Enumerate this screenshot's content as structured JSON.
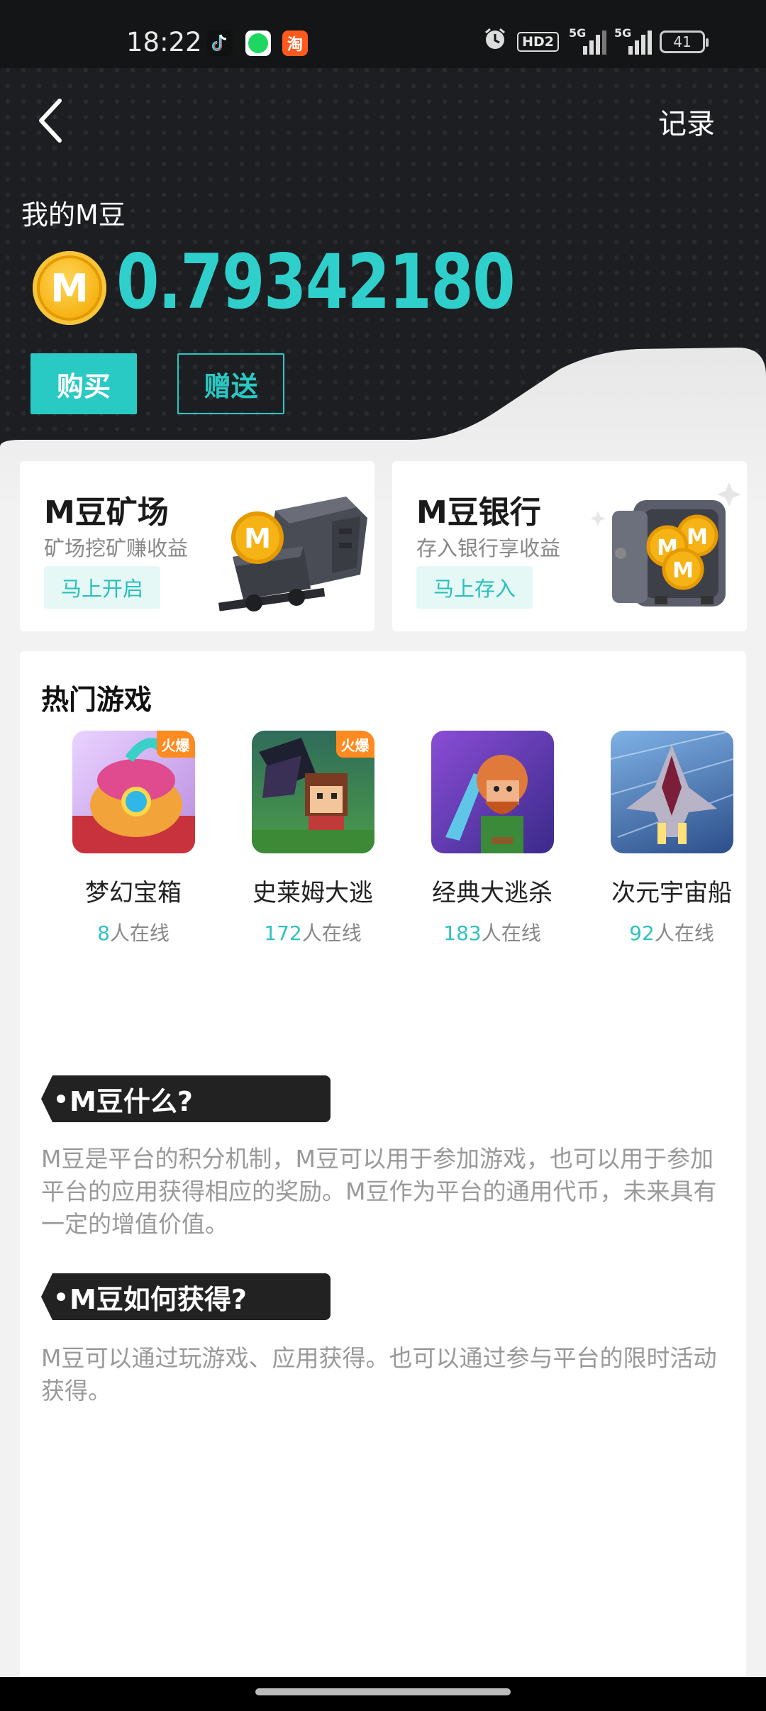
{
  "status_bar": {
    "time": "18:22",
    "apps": [
      "tiktok-icon",
      "spotify-icon",
      "taobao-icon"
    ],
    "taobao_glyph": "淘",
    "hd_label": "HD2",
    "network_labels": [
      "5G",
      "5G"
    ],
    "battery": "41"
  },
  "header": {
    "back_icon": "chevron-left-icon",
    "record_label": "记录"
  },
  "wallet": {
    "title": "我的M豆",
    "coin_letter": "M",
    "balance": "0.79342180",
    "buy_label": "购买",
    "gift_label": "赠送"
  },
  "cards": {
    "mine": {
      "title": "M豆矿场",
      "subtitle": "矿场挖矿赚收益",
      "button": "马上开启"
    },
    "bank": {
      "title": "M豆银行",
      "subtitle": "存入银行享收益",
      "button": "马上存入"
    }
  },
  "hot_games": {
    "title": "热门游戏",
    "online_suffix": "人在线",
    "items": [
      {
        "name": "梦幻宝箱",
        "online": "8",
        "badge": "火爆"
      },
      {
        "name": "史莱姆大逃",
        "online": "172",
        "badge": "火爆"
      },
      {
        "name": "经典大逃杀",
        "online": "183",
        "badge": ""
      },
      {
        "name": "次元宇宙船",
        "online": "92",
        "badge": ""
      }
    ]
  },
  "faq": [
    {
      "question": "M豆什么?",
      "answer": "M豆是平台的积分机制，M豆可以用于参加游戏，也可以用于参加平台的应用获得相应的奖励。M豆作为平台的通用代币，未来具有一定的增值价值。"
    },
    {
      "question": "M豆如何获得?",
      "answer": "M豆可以通过玩游戏、应用获得。也可以通过参与平台的限时活动获得。"
    }
  ],
  "colors": {
    "accent": "#29c9c4",
    "dark_bg": "#1c1e21",
    "badge_orange": "#ff8a1f",
    "coin_gold": "#f6b315"
  }
}
